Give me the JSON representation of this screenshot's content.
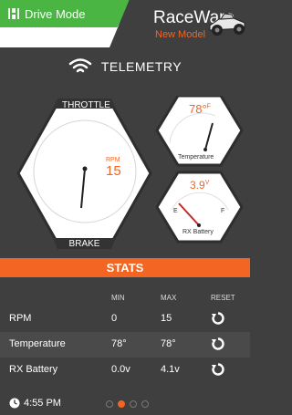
{
  "header": {
    "mode_label": "Drive Mode",
    "brand": "RaceWare",
    "subtitle": "New Model"
  },
  "telemetry": {
    "title": "TELEMETRY"
  },
  "gauges": {
    "throttle_label": "THROTTLE",
    "brake_label": "BRAKE",
    "rpm_unit": "RPM",
    "rpm_value": "15",
    "temperature_value": "78°",
    "temperature_unit": "F",
    "temperature_label": "Temperature",
    "battery_value": "3.9",
    "battery_unit": "V",
    "battery_label": "RX Battery",
    "battery_empty": "E",
    "battery_full": "F"
  },
  "stats": {
    "title": "STATS",
    "columns": [
      "MIN",
      "MAX",
      "RESET"
    ],
    "rows": [
      {
        "name": "RPM",
        "min": "0",
        "max": "15"
      },
      {
        "name": "Temperature",
        "min": "78°",
        "max": "78°"
      },
      {
        "name": "RX Battery",
        "min": "0.0v",
        "max": "4.1v"
      }
    ]
  },
  "footer": {
    "time": "4:55 PM",
    "page_count": 4,
    "active_page": 2
  },
  "colors": {
    "accent": "#f26522",
    "green": "#4bb543",
    "background": "#3f3f3f"
  }
}
